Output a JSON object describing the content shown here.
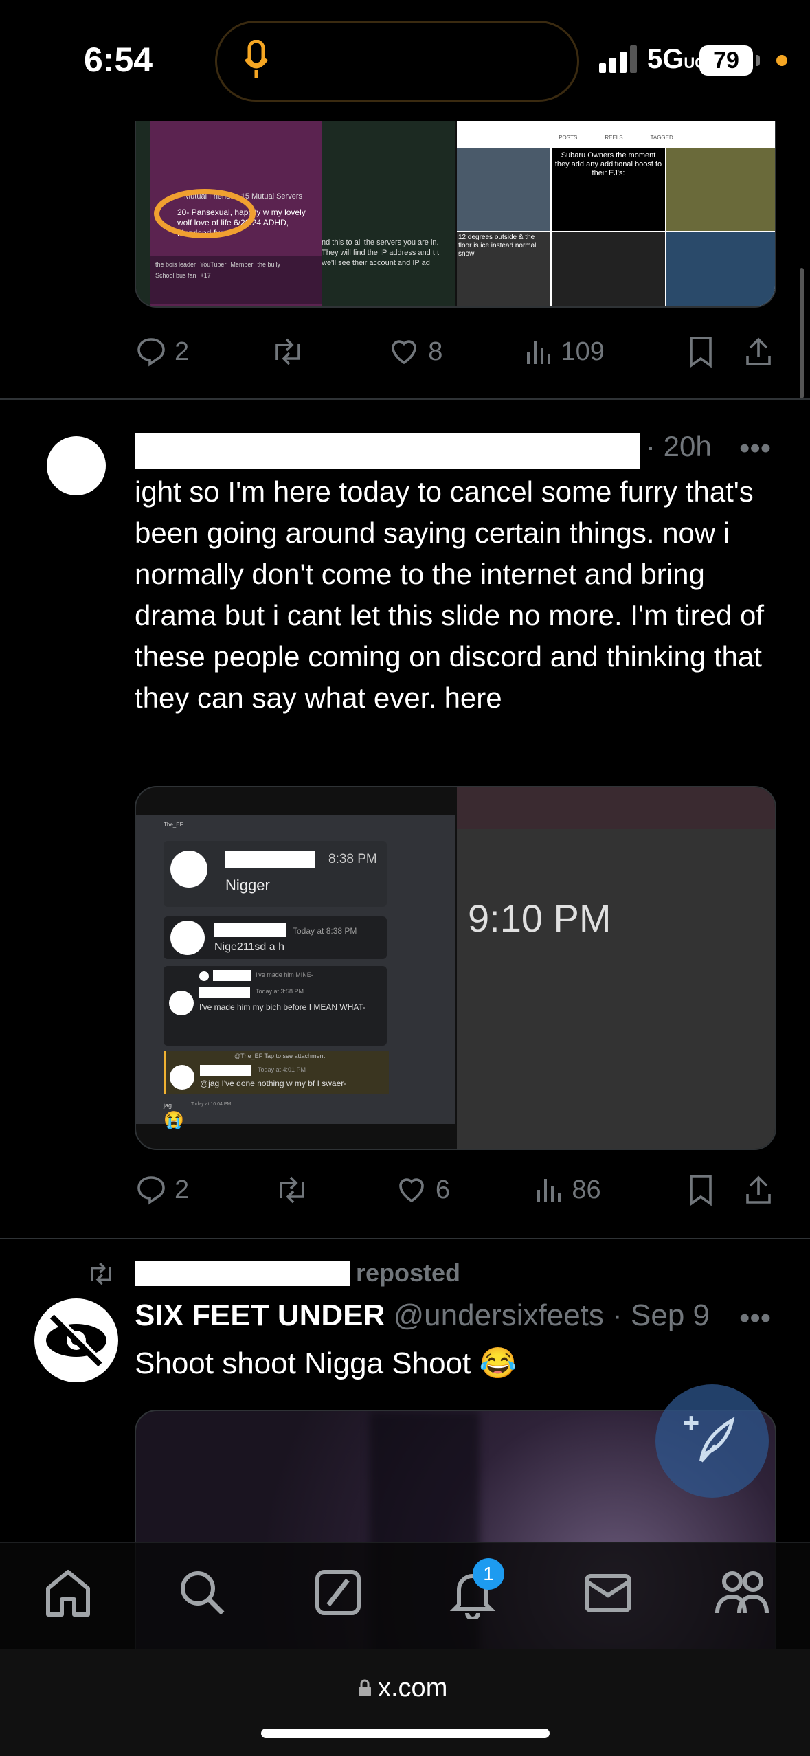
{
  "status_bar": {
    "time": "6:54",
    "network": "5G",
    "network_suffix": "UC",
    "battery": "79"
  },
  "post1": {
    "media_right": {
      "header": [
        "POSTS",
        "REELS",
        "TAGGED"
      ],
      "caption1": "Subaru Owners the moment they add any additional boost to their EJ's:",
      "caption2": "12 degrees outside & the floor is ice instead normal snow"
    },
    "media_left": {
      "line1": "Mutual Friends • 15 Mutual Servers",
      "line2": "20- Pansexual, happily w my lovely wolf love of life 6/29/24 ADHD, Maryland fur",
      "tags": [
        "the bois leader",
        "YouTuber",
        "Member",
        "the bully",
        "School bus fan",
        "+17"
      ],
      "side_text": "nd this to all the servers you are in. They will find the IP address and t t we'll see their account and IP ad"
    },
    "replies": "2",
    "likes": "8",
    "views": "109"
  },
  "post2": {
    "time": "· 20h",
    "text": "ight so I'm here today to cancel some furry that's been going around saying certain things. now i normally don't come to the internet and bring drama but i cant let this slide no more. I'm tired of these people coming on discord and thinking that they can say what ever. here",
    "media_left": {
      "header_name": "The_EF",
      "msg1_time": "8:38 PM",
      "msg1_text": "Nigger",
      "msg2_time": "Today at 8:38 PM",
      "msg2_text": "Nige211sd a h",
      "msg3_reply": "I've made him MINE-",
      "msg3_time": "Today at 3:58 PM",
      "msg3_text": "I've made him my bich before I MEAN WHAT-",
      "msg4_reply": "@The_EF Tap to see attachment",
      "msg4_time": "Today at 4:01 PM",
      "msg4_text": "@jag I've done nothing w my bf I swaer-",
      "msg5_name": "jag",
      "msg5_time": "Today at 10:04 PM",
      "msg5_emoji": "😭"
    },
    "media_right_time": "9:10 PM",
    "replies": "2",
    "likes": "6",
    "views": "86"
  },
  "post3": {
    "repost_label": "reposted",
    "name": "SIX FEET UNDER",
    "handle": "@undersixfeets",
    "time": "· Sep 9",
    "text": "Shoot shoot Nigga Shoot 😂"
  },
  "tabs": [
    "home-icon",
    "search-icon",
    "grok-icon",
    "notifications-icon",
    "messages-icon",
    "communities-icon"
  ],
  "notification_badge": "1",
  "browser": {
    "url": "x.com"
  },
  "colors": {
    "accent": "#1d9bf0",
    "muted": "#71767b",
    "divider": "#2f3336"
  }
}
